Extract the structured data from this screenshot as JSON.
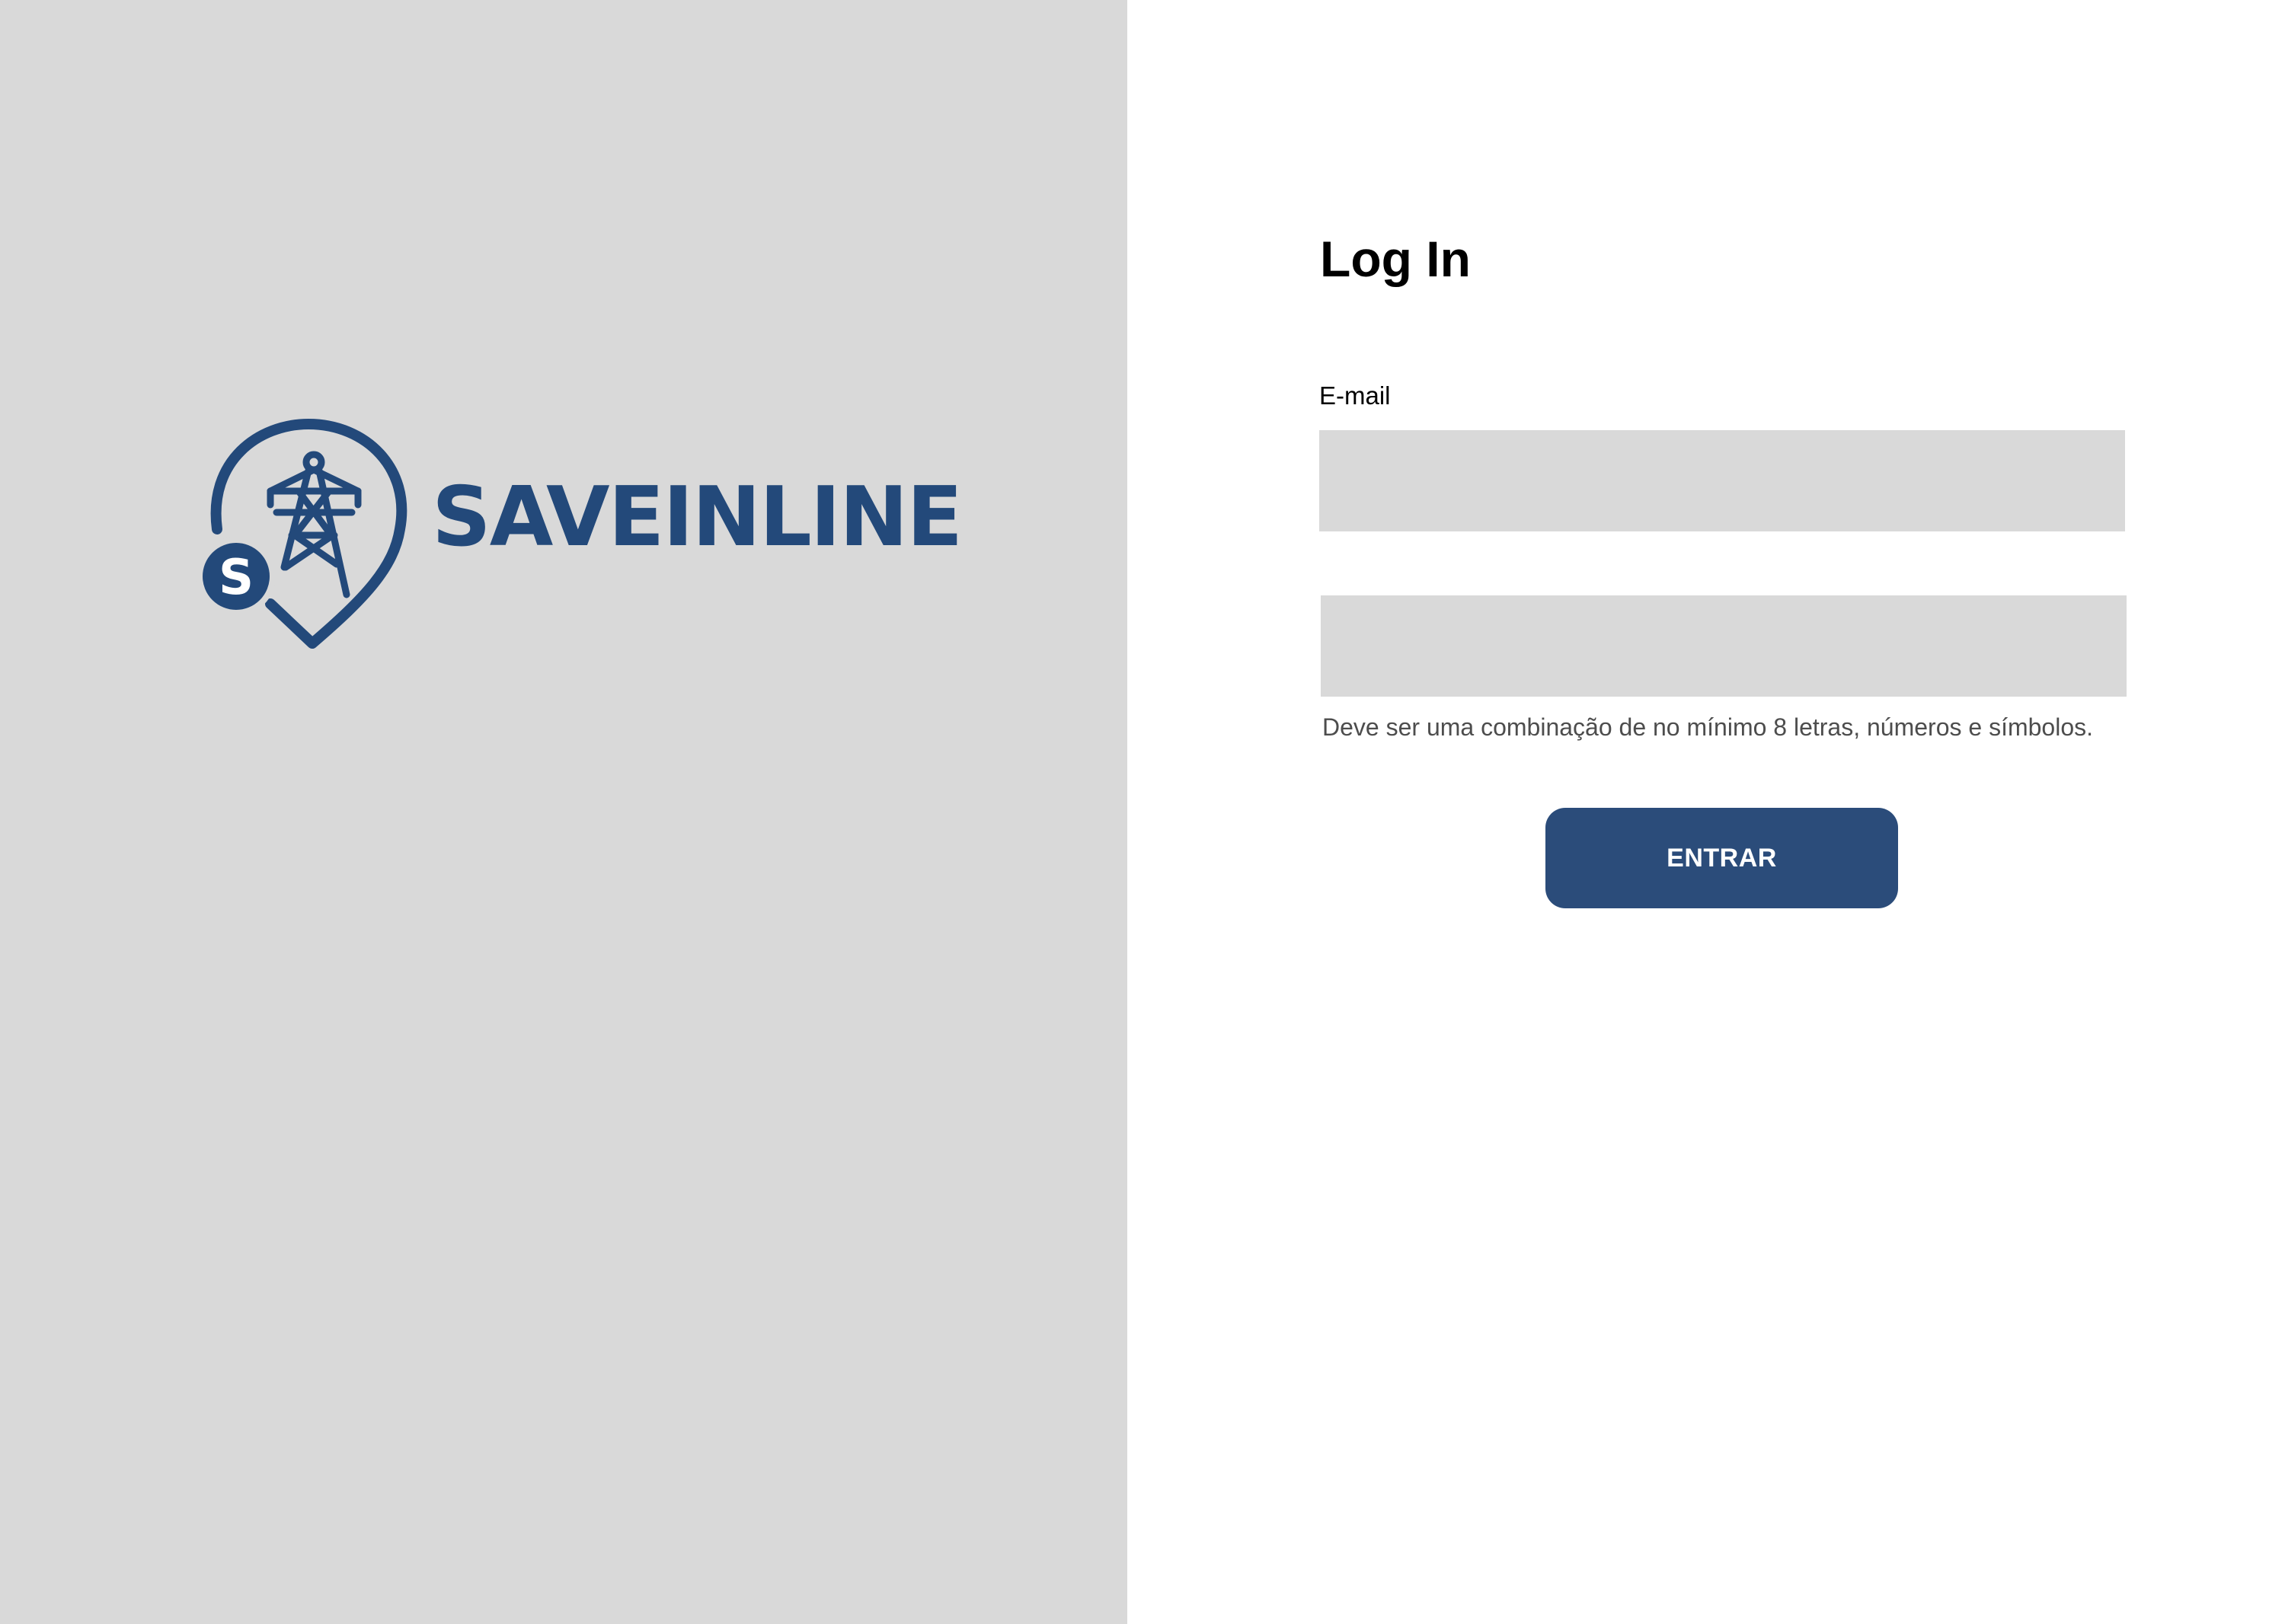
{
  "brand": {
    "name": "SAVEINLINE",
    "logo_letter": "S",
    "color": "#23497a",
    "icon": "pin-tower-coin-icon"
  },
  "login": {
    "title": "Log In",
    "email_label": "E-mail",
    "email_value": "",
    "password_value": "",
    "password_hint": "Deve ser uma combinação de no mínimo 8 letras, números e símbolos.",
    "submit_label": "ENTRAR"
  },
  "colors": {
    "left_panel_bg": "#d9d9d9",
    "field_bg": "#d9d9d9",
    "button_bg": "#2b4c7a",
    "button_text": "#ffffff"
  }
}
